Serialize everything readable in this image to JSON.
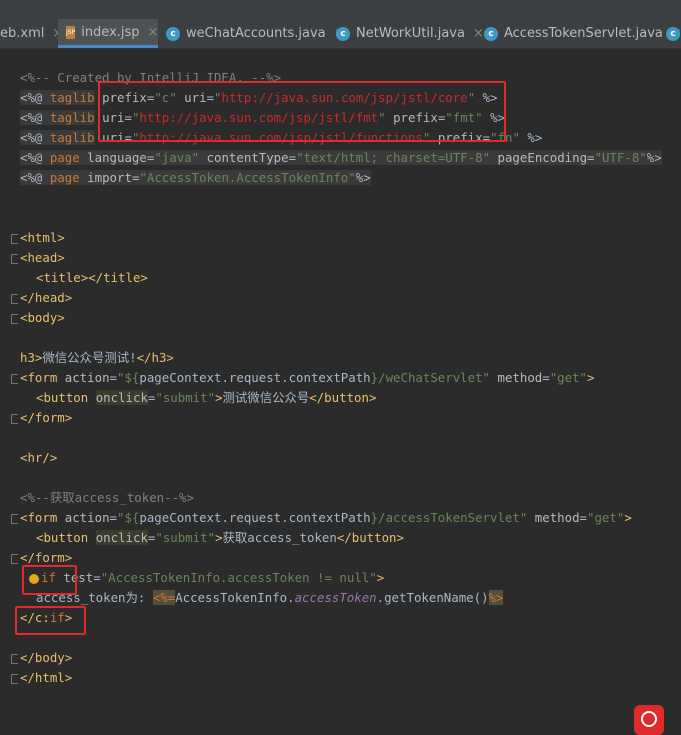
{
  "tabs": [
    {
      "label": "eb.xml",
      "icon": "xml-file-icon"
    },
    {
      "label": "index.jsp",
      "icon": "jsp-file-icon",
      "active": true
    },
    {
      "label": "weChatAccounts.java",
      "icon": "java-class-icon"
    },
    {
      "label": "NetWorkUtil.java",
      "icon": "java-class-icon"
    },
    {
      "label": "AccessTokenServlet.java",
      "icon": "java-class-icon"
    }
  ],
  "close_glyph": "×",
  "jsp_badge": "JSP",
  "class_badge": "c",
  "code": {
    "comment1": "<%-- Created by IntelliJ IDEA. --%>",
    "open_dir": "<%@ ",
    "close_dir": " %>",
    "taglib": "taglib",
    "page": "page",
    "prefix_attr": "prefix",
    "uri_attr": "uri",
    "core_prefix": "\"c\"",
    "core_uri": "http://java.sun.com/jsp/jstl/core",
    "fmt_uri": "http://java.sun.com/jsp/jstl/fmt",
    "fmt_prefix": "\"fmt\"",
    "fn_uri": "http://java.sun.com/jsp/jstl/functions",
    "fn_prefix": "\"fn\"",
    "language_attr": "language",
    "language_val": "\"java\"",
    "content_type_attr": "contentType",
    "content_type_val": "\"text/html; charset=UTF-8\"",
    "page_encoding_attr": "pageEncoding",
    "page_encoding_val": "\"UTF-8\"",
    "import_attr": "import",
    "import_val": "\"AccessToken.AccessTokenInfo\"",
    "html_open": "<html>",
    "head_open": "<head>",
    "title_line": "<title></title>",
    "head_close": "</head>",
    "body_open": "<body>",
    "h3_open": "h3>",
    "h3_text": "微信公众号测试!",
    "h3_close": "</h3>",
    "form_open": "<form ",
    "action_attr": "action",
    "form1_action_pre": "\"${",
    "form_action_expr": "pageContext.request.contextPath",
    "form1_action_post": "}/weChatServlet\"",
    "method_attr": "method",
    "method_val": "\"get\"",
    "gt": ">",
    "button_open": "<button ",
    "onclick_attr": "onclick",
    "onclick_val": "\"submit\"",
    "button1_text": "测试微信公众号",
    "button_close": "</button>",
    "form_close": "</form>",
    "hr": "<hr/>",
    "comment2": "<%--获取access_token--%>",
    "form2_action_post": "}/accessTokenServlet\"",
    "button2_text": "获取access_token",
    "if_tag": "if",
    "test_attr": "test",
    "test_val": "\"AccessTokenInfo.accessToken != null\"",
    "access_label": "access_token为: ",
    "expr_open": "<%=",
    "expr_class": "AccessTokenInfo.",
    "expr_field": "accessToken",
    "expr_call": ".getTokenName()",
    "expr_close": "%>",
    "if_close_pre": "</c:",
    "if_close_name": "if",
    "body_close": "</body>",
    "html_close": "</html>",
    "eq": "="
  },
  "colors": {
    "background": "#2b2b2b",
    "annotation_red": "#e02b2b",
    "keyword": "#cc7832",
    "string": "#6a8759",
    "tag": "#e8bf6a",
    "url": "#cc2a2a"
  }
}
